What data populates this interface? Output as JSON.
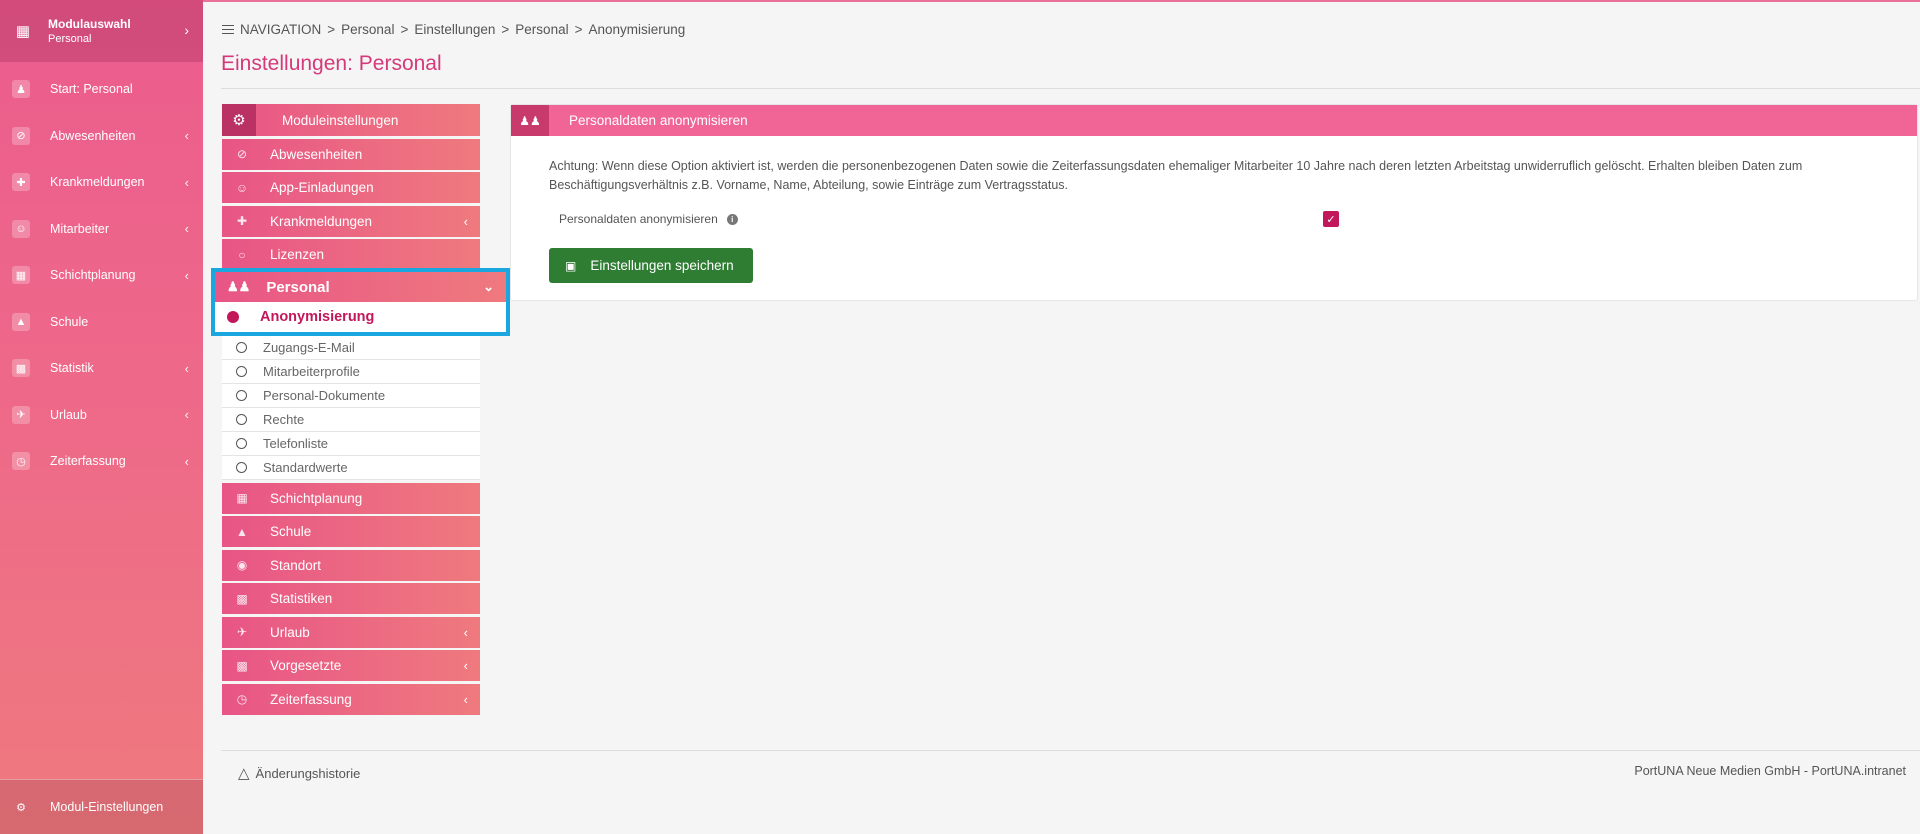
{
  "sidebar": {
    "header": {
      "title": "Modulauswahl",
      "subtitle": "Personal"
    },
    "items": [
      {
        "label": "Start: Personal",
        "icon": "users-icon",
        "has_chevron": false
      },
      {
        "label": "Abwesenheiten",
        "icon": "ban-icon",
        "has_chevron": true
      },
      {
        "label": "Krankmeldungen",
        "icon": "medical-plus-icon",
        "has_chevron": true
      },
      {
        "label": "Mitarbeiter",
        "icon": "user-icon",
        "has_chevron": true
      },
      {
        "label": "Schichtplanung",
        "icon": "calendar-table-icon",
        "has_chevron": true
      },
      {
        "label": "Schule",
        "icon": "graduation-cap-icon",
        "has_chevron": false
      },
      {
        "label": "Statistik",
        "icon": "chart-icon",
        "has_chevron": true
      },
      {
        "label": "Urlaub",
        "icon": "plane-icon",
        "has_chevron": true
      },
      {
        "label": "Zeiterfassung",
        "icon": "clock-icon",
        "has_chevron": true
      }
    ],
    "footer": {
      "label": "Modul-Einstellungen"
    }
  },
  "breadcrumb": {
    "nav_label": "NAVIGATION",
    "items": [
      "Personal",
      "Einstellungen",
      "Personal",
      "Anonymisierung"
    ]
  },
  "page_title": "Einstellungen: Personal",
  "settings_menu": {
    "header": "Moduleinstellungen",
    "items_top": [
      {
        "label": "Abwesenheiten",
        "icon": "ban-icon",
        "has_chevron": false
      },
      {
        "label": "App-Einladungen",
        "icon": "user-icon",
        "has_chevron": false
      },
      {
        "label": "Krankmeldungen",
        "icon": "medical-plus-icon",
        "has_chevron": true
      },
      {
        "label": "Lizenzen",
        "icon": "circle-icon",
        "has_chevron": false
      }
    ],
    "active_group": {
      "label": "Personal",
      "icon": "users-icon"
    },
    "active_item": "Anonymisierung",
    "sub_items": [
      "Zugangs-E-Mail",
      "Mitarbeiterprofile",
      "Personal-Dokumente",
      "Rechte",
      "Telefonliste",
      "Standardwerte"
    ],
    "items_bottom": [
      {
        "label": "Schichtplanung",
        "icon": "calendar-table-icon",
        "has_chevron": false
      },
      {
        "label": "Schule",
        "icon": "graduation-cap-icon",
        "has_chevron": false
      },
      {
        "label": "Standort",
        "icon": "map-pin-icon",
        "has_chevron": false
      },
      {
        "label": "Statistiken",
        "icon": "chart-icon",
        "has_chevron": false
      },
      {
        "label": "Urlaub",
        "icon": "plane-icon",
        "has_chevron": true
      },
      {
        "label": "Vorgesetzte",
        "icon": "chart-icon",
        "has_chevron": true
      },
      {
        "label": "Zeiterfassung",
        "icon": "clock-icon",
        "has_chevron": true
      }
    ]
  },
  "panel": {
    "title": "Personaldaten anonymisieren",
    "description": "Achtung: Wenn diese Option aktiviert ist, werden die personenbezogenen Daten sowie die Zeiterfassungsdaten ehemaliger Mitarbeiter 10 Jahre nach deren letzten Arbeitstag unwiderruflich gelöscht. Erhalten bleiben Daten zum Beschäftigungsverhältnis z.B. Vorname, Name, Abteilung, sowie Einträge zum Vertragsstatus.",
    "option_label": "Personaldaten anonymisieren",
    "option_checked": true,
    "save_label": "Einstellungen speichern"
  },
  "footer": {
    "history_label": "Änderungshistorie",
    "copyright": "PortUNA Neue Medien GmbH - PortUNA.intranet"
  },
  "colors": {
    "brand_pink": "#ec5c8e",
    "accent_magenta": "#c2185b",
    "save_green": "#2e7d32",
    "highlight_blue": "#1aa6de"
  }
}
